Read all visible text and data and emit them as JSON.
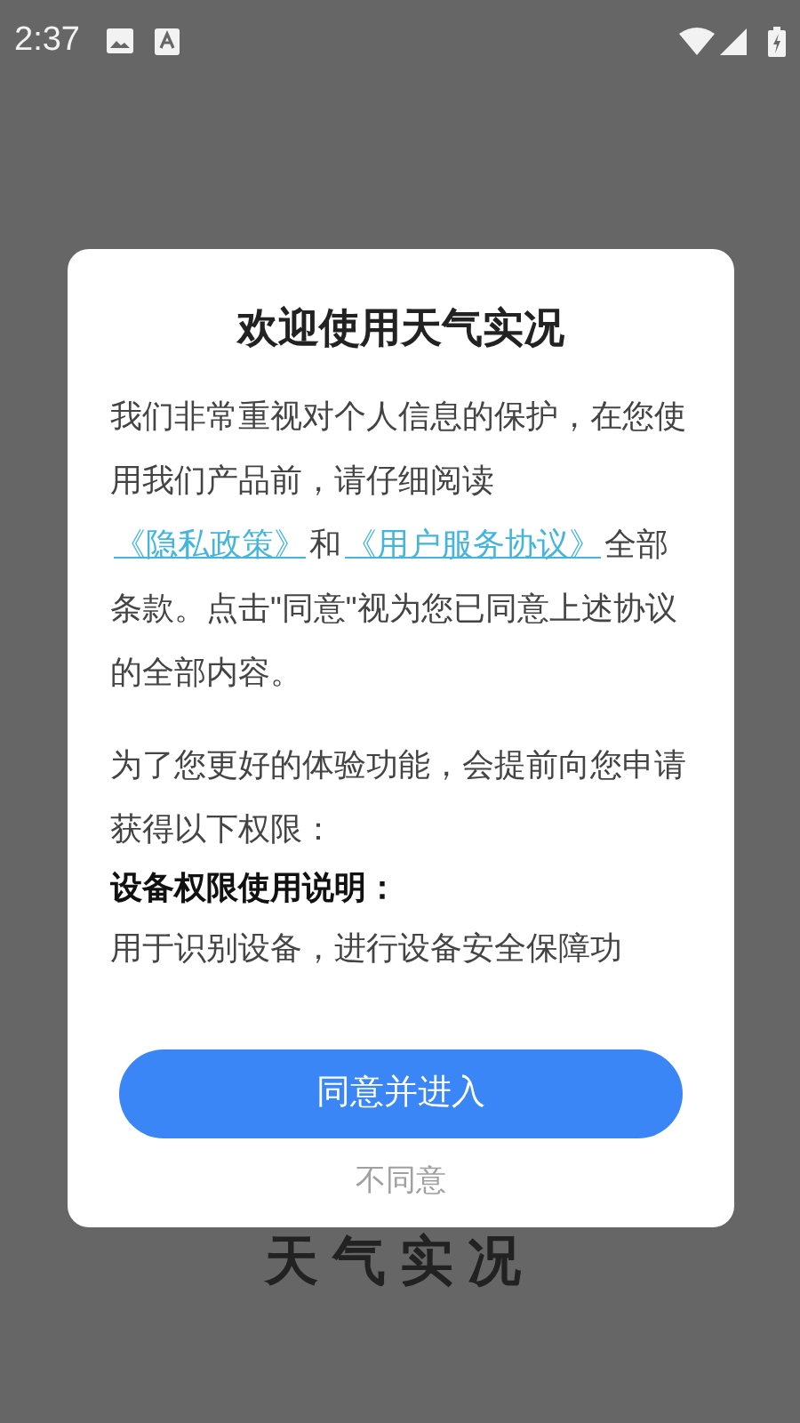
{
  "status_bar": {
    "time": "2:37"
  },
  "background": {
    "app_title": "天气实况"
  },
  "dialog": {
    "title": "欢迎使用天气实况",
    "intro": [
      {
        "kind": "text",
        "text": "我们非常重视对个人信息的保护，在您使用我们产品前，请仔细阅读"
      },
      {
        "kind": "link",
        "text": "《隐私政策》"
      },
      {
        "kind": "text",
        "text": "和"
      },
      {
        "kind": "link",
        "text": "《用户服务协议》"
      },
      {
        "kind": "text",
        "text": "全部条款。点击\"同意\"视为您已同意上述协议的全部内容。"
      }
    ],
    "permissions_intro": "为了您更好的体验功能，会提前向您申请获得以下权限：",
    "permission_heading": "设备权限使用说明：",
    "permission_text": "用于识别设备，进行设备安全保障功",
    "agree_button": "同意并进入",
    "decline_button": "不同意"
  }
}
